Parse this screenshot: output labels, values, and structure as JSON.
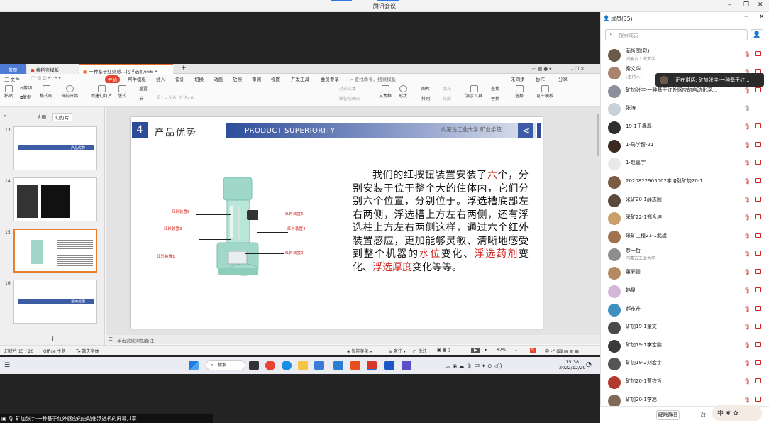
{
  "window": {
    "title": "腾讯会议"
  },
  "wps": {
    "tabs": {
      "home": "首页",
      "find": "找稻壳模板",
      "doc": "一种基于红外感...化浮选机666"
    },
    "menu": [
      "三 文件",
      "开始",
      "插入",
      "设计",
      "切换",
      "动画",
      "放映",
      "审阅",
      "视图",
      "开发工具",
      "会员专享"
    ],
    "menu_search": "查找命令、搜索模板",
    "right_actions": [
      "未同步",
      "协作",
      "分享"
    ],
    "tools": {
      "cut": "剪切",
      "paste": "粘贴",
      "copy": "复制",
      "format_painter": "格式刷",
      "from_current": "当前开始",
      "new_slide": "新建幻灯片",
      "layout": "版式",
      "section": "节",
      "reset": "重置",
      "textbox": "文本框",
      "shape": "形状",
      "arrange": "排列",
      "picture": "图片",
      "fill": "填充",
      "outline": "轮廓",
      "present_tool": "演示工具",
      "find": "查找",
      "replace": "替换",
      "select": "选择",
      "template": "可牛模板",
      "align": "对齐文本",
      "smart": "转智能图形"
    },
    "panel": {
      "outline": "大纲",
      "slides": "幻灯片"
    },
    "thumbs": [
      {
        "num": "13",
        "caption": "产品优势"
      },
      {
        "num": "14"
      },
      {
        "num": "15"
      },
      {
        "num": "16",
        "caption": "适用范围"
      }
    ],
    "slide": {
      "number": "4",
      "title": "产品优势",
      "en_title": "PRODUCT SUPERIORITY",
      "univ": "内蒙古工业大学 矿业学院",
      "text_parts": [
        {
          "t": "我们的红按钮装置安装了",
          "hl": false
        },
        {
          "t": "六",
          "hl": true
        },
        {
          "t": "个，分别安装于位于整个大的住体内，它们分别六个位置，分别位于。浮选槽底部左右两侧，浮选槽上方左右两侧，还有浮选柱上方左右两侧这样，通过六个红外装置感应，更加能够灵敏、清晰地感受到整个机器的",
          "hl": false
        },
        {
          "t": "水位",
          "hl": true
        },
        {
          "t": "变化、",
          "hl": false
        },
        {
          "t": "浮选药剂",
          "hl": true
        },
        {
          "t": "变化、",
          "hl": false
        },
        {
          "t": "浮选厚度",
          "hl": true
        },
        {
          "t": "变化等等。",
          "hl": false
        }
      ],
      "labels": {
        "l1": "红外装置5",
        "l2": "红外装置3",
        "l3": "红外装置1",
        "r1": "红外装置6",
        "r2": "红外装置4",
        "r3": "红外装置2"
      }
    },
    "notes": "单击此处添加备注",
    "status": {
      "slide": "幻灯片 15 / 20",
      "theme": "Office 主题",
      "font": "缺失字体",
      "beautify": "智能美化",
      "notes": "备注",
      "comments": "批注",
      "zoom": "82%"
    }
  },
  "taskbar": {
    "search": "搜索",
    "time": "15:38",
    "date": "2022/12/29",
    "ime": "中"
  },
  "share_status": "矿加张宇-一种基于红外感应的自动化浮选机的屏幕共享",
  "members": {
    "title": "成员(35)",
    "search_placeholder": "搜索成员",
    "speaking": "正在讲话: 矿加张宇-一种基于红...",
    "list": [
      {
        "name": "蔺哲国(我)",
        "sub": "内蒙古工业大学",
        "color": "#6b5a4a"
      },
      {
        "name": "秦文华",
        "sub": "(主持人)",
        "color": "#a98270"
      },
      {
        "name": "矿加张宇-一种基于红外感应的自动化浮...",
        "sub": "",
        "color": "#8a8f9a"
      },
      {
        "name": "张涛",
        "sub": "",
        "color": "#c8d0d8"
      },
      {
        "name": "19-1王鑫磊",
        "sub": "",
        "color": "#2f2f2f"
      },
      {
        "name": "1-马学智-21",
        "sub": "",
        "color": "#3a2a22"
      },
      {
        "name": "1-赵嘉宇",
        "sub": "",
        "color": "#e9e9e9"
      },
      {
        "name": "2020822905002李培毅矿加20-1",
        "sub": "",
        "color": "#7b5d45"
      },
      {
        "name": "采矿20-1薛志超",
        "sub": "",
        "color": "#5b4a3c"
      },
      {
        "name": "采矿22-1郑含坤",
        "sub": "",
        "color": "#c9a06a"
      },
      {
        "name": "采矿工程21-1武斌",
        "sub": "",
        "color": "#a1724e"
      },
      {
        "name": "恭一哲",
        "sub": "内蒙古工业大学",
        "color": "#8e8e8e"
      },
      {
        "name": "董彩霞",
        "sub": "",
        "color": "#b58a62"
      },
      {
        "name": "韩星",
        "sub": "",
        "color": "#d4b6d9"
      },
      {
        "name": "郝东升",
        "sub": "",
        "color": "#3f8fbf"
      },
      {
        "name": "矿加19-1董文",
        "sub": "",
        "color": "#4a4a4a"
      },
      {
        "name": "矿加19-1李宏鹏",
        "sub": "",
        "color": "#3a3a3a"
      },
      {
        "name": "矿加19-2刘宏宇",
        "sub": "",
        "color": "#555"
      },
      {
        "name": "矿加20-1曹铁哲",
        "sub": "",
        "color": "#b2392c"
      },
      {
        "name": "矿加20-1李旭",
        "sub": "",
        "color": "#7f6a55"
      }
    ],
    "unmute_all": "解除静音",
    "all_label": "改"
  }
}
